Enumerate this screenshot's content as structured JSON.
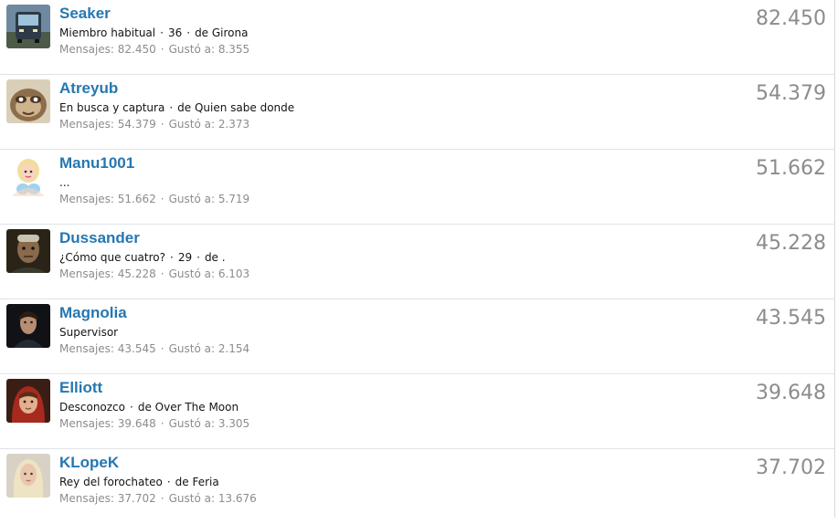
{
  "members": [
    {
      "name": "Seaker",
      "blurb": [
        "Miembro habitual",
        "36",
        "de Girona"
      ],
      "messages_label": "Mensajes: 82.450",
      "likes_label": "Gustó a: 8.355",
      "score": "82.450",
      "avatar_icon": "bus-photo-avatar"
    },
    {
      "name": "Atreyub",
      "blurb": [
        "En busca y captura",
        "de Quien sabe donde"
      ],
      "messages_label": "Mensajes: 54.379",
      "likes_label": "Gustó a: 2.373",
      "score": "54.379",
      "avatar_icon": "sloth-avatar"
    },
    {
      "name": "Manu1001",
      "blurb": [
        "..."
      ],
      "messages_label": "Mensajes: 51.662",
      "likes_label": "Gustó a: 5.719",
      "score": "51.662",
      "avatar_icon": "cartoon-woman-avatar"
    },
    {
      "name": "Dussander",
      "blurb": [
        "¿Cómo que cuatro?",
        "29",
        "de ."
      ],
      "messages_label": "Mensajes: 45.228",
      "likes_label": "Gustó a: 6.103",
      "score": "45.228",
      "avatar_icon": "old-man-photo-avatar"
    },
    {
      "name": "Magnolia",
      "blurb": [
        "Supervisor"
      ],
      "messages_label": "Mensajes: 43.545",
      "likes_label": "Gustó a: 2.154",
      "score": "43.545",
      "avatar_icon": "man-portrait-avatar"
    },
    {
      "name": "Elliott",
      "blurb": [
        "Desconozco",
        "de Over The Moon"
      ],
      "messages_label": "Mensajes: 39.648",
      "likes_label": "Gustó a: 3.305",
      "score": "39.648",
      "avatar_icon": "boy-red-hoodie-avatar"
    },
    {
      "name": "KLopeK",
      "blurb": [
        "Rey del forochateo",
        "de Feria"
      ],
      "messages_label": "Mensajes: 37.702",
      "likes_label": "Gustó a: 13.676",
      "score": "37.702",
      "avatar_icon": "blonde-woman-avatar"
    }
  ],
  "colors": {
    "username": "#2577b1",
    "muted": "#8c8c8c",
    "divider": "#dfe3e8"
  }
}
